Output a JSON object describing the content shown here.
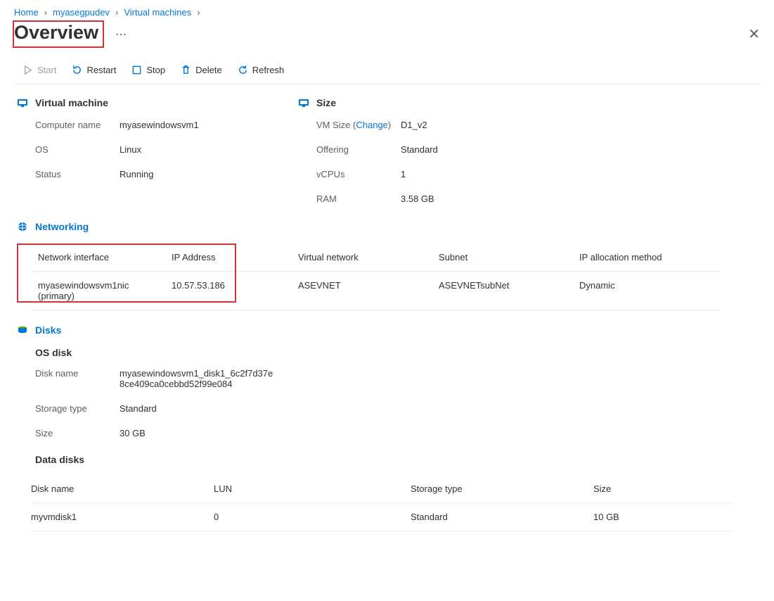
{
  "breadcrumb": {
    "home": "Home",
    "resource": "myasegpudev",
    "section": "Virtual machines"
  },
  "title": "Overview",
  "toolbar": {
    "start": "Start",
    "restart": "Restart",
    "stop": "Stop",
    "delete": "Delete",
    "refresh": "Refresh"
  },
  "vm": {
    "heading": "Virtual machine",
    "computer_name_k": "Computer name",
    "computer_name_v": "myasewindowsvm1",
    "os_k": "OS",
    "os_v": "Linux",
    "status_k": "Status",
    "status_v": "Running"
  },
  "size": {
    "heading": "Size",
    "vmsize_k": "VM Size",
    "change": "Change",
    "vmsize_v": "D1_v2",
    "offering_k": "Offering",
    "offering_v": "Standard",
    "vcpus_k": "vCPUs",
    "vcpus_v": "1",
    "ram_k": "RAM",
    "ram_v": "3.58 GB"
  },
  "networking": {
    "heading": "Networking",
    "headers": {
      "nic": "Network interface",
      "ip": "IP Address",
      "vnet": "Virtual network",
      "subnet": "Subnet",
      "alloc": "IP allocation method"
    },
    "row": {
      "nic": "myasewindowsvm1nic (primary)",
      "ip": "10.57.53.186",
      "vnet": "ASEVNET",
      "subnet": "ASEVNETsubNet",
      "alloc": "Dynamic"
    }
  },
  "disks": {
    "heading": "Disks",
    "os_heading": "OS disk",
    "name_k": "Disk name",
    "name_v": "myasewindowsvm1_disk1_6c2f7d37e8ce409ca0cebbd52f99e084",
    "storage_k": "Storage type",
    "storage_v": "Standard",
    "size_k": "Size",
    "size_v": "30 GB",
    "data_heading": "Data disks",
    "dd_headers": {
      "name": "Disk name",
      "lun": "LUN",
      "storage": "Storage type",
      "size": "Size"
    },
    "dd_row": {
      "name": "myvmdisk1",
      "lun": "0",
      "storage": "Standard",
      "size": "10 GB"
    }
  }
}
